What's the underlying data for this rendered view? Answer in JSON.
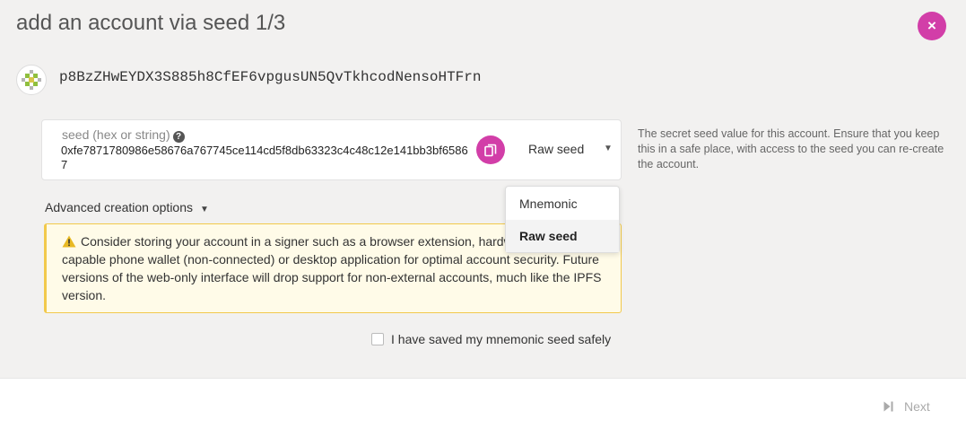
{
  "modal": {
    "title": "add an account via seed 1/3",
    "close_label": "×",
    "accent_color": "#d23ea8"
  },
  "account": {
    "address": "p8BzZHwEYDX3S885h8CfEF6vpgusUN5QvTkhcodNensoHTFrn",
    "identicon": "identicon"
  },
  "seed": {
    "label": "seed (hex or string)",
    "value": "0xfe7871780986e58676a767745ce114cd5f8db63323c4c48c12e141bb3bf65867",
    "type_selected": "Raw seed",
    "help": "The secret seed value for this account. Ensure that you keep this in a safe place, with access to the seed you can re-create the account."
  },
  "advanced": {
    "label": "Advanced creation options"
  },
  "dropdown": {
    "options": [
      "Mnemonic",
      "Raw seed"
    ]
  },
  "warning": {
    "text": "Consider storing your account in a signer such as a browser extension, hardware device, QR-capable phone wallet (non-connected) or desktop application for optimal account security. Future versions of the web-only interface will drop support for non-external accounts, much like the IPFS version."
  },
  "confirm": {
    "label": "I have saved my mnemonic seed safely"
  },
  "footer": {
    "next_label": "Next"
  }
}
